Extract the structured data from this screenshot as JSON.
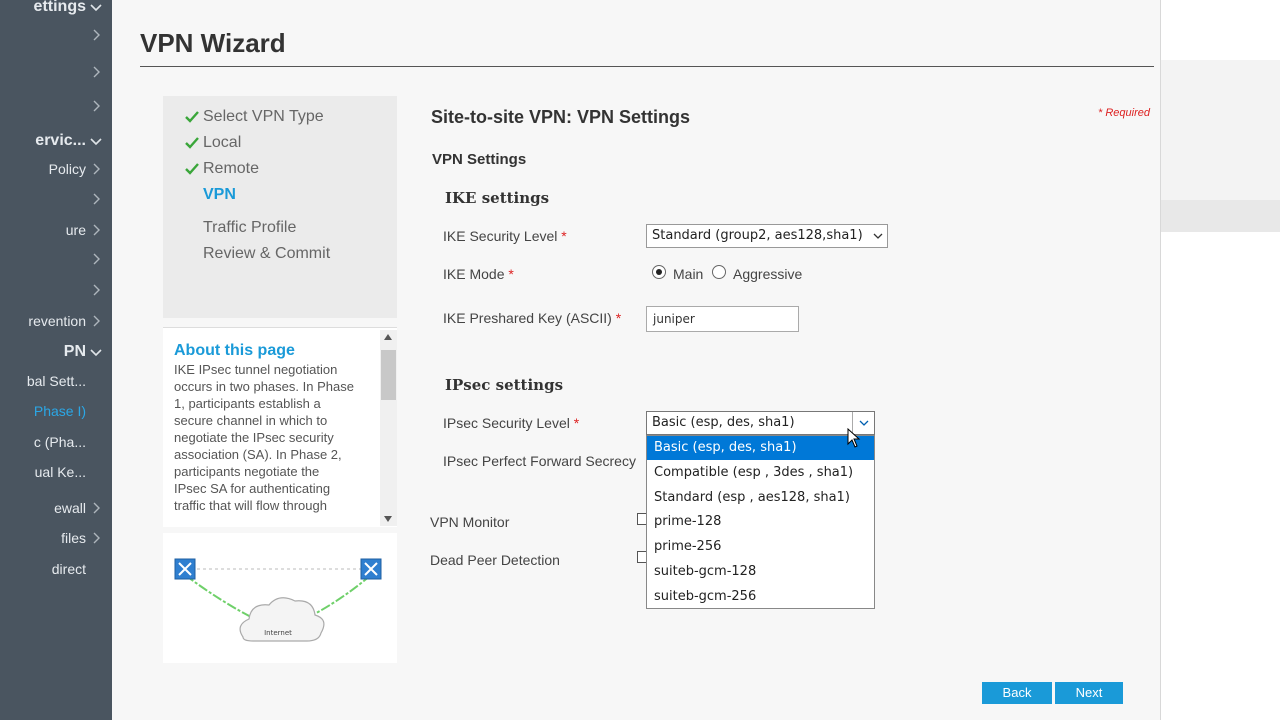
{
  "sidebar": {
    "items": [
      {
        "label": "ettings",
        "style": "bold",
        "chevron": "down"
      },
      {
        "label": "",
        "style": "",
        "chevron": "right"
      },
      {
        "label": "",
        "style": "",
        "chevron": "right"
      },
      {
        "label": "",
        "style": "",
        "chevron": "right"
      },
      {
        "label": "ervic...",
        "style": "bold",
        "chevron": "down"
      },
      {
        "label": "Policy",
        "style": "",
        "chevron": "right"
      },
      {
        "label": "",
        "style": "",
        "chevron": "right"
      },
      {
        "label": "ure",
        "style": "",
        "chevron": "right"
      },
      {
        "label": "",
        "style": "",
        "chevron": "right"
      },
      {
        "label": "",
        "style": "",
        "chevron": "right"
      },
      {
        "label": "revention",
        "style": "",
        "chevron": "right"
      },
      {
        "label": "PN",
        "style": "bold",
        "chevron": "down"
      },
      {
        "label": "bal Sett...",
        "style": "",
        "chevron": ""
      },
      {
        "label": "Phase I)",
        "style": "active",
        "chevron": ""
      },
      {
        "label": "c (Pha...",
        "style": "",
        "chevron": ""
      },
      {
        "label": "ual Ke...",
        "style": "",
        "chevron": ""
      },
      {
        "label": "ewall",
        "style": "",
        "chevron": "right"
      },
      {
        "label": "files",
        "style": "",
        "chevron": "right"
      },
      {
        "label": "direct",
        "style": "",
        "chevron": ""
      }
    ]
  },
  "page": {
    "title": "VPN Wizard",
    "required_note": "* Required"
  },
  "steps": [
    {
      "label": "Select VPN Type",
      "done": true
    },
    {
      "label": "Local",
      "done": true
    },
    {
      "label": "Remote",
      "done": true
    },
    {
      "label": "VPN",
      "done": false,
      "current": true
    },
    {
      "label": "Traffic Profile",
      "done": false
    },
    {
      "label": "Review & Commit",
      "done": false
    }
  ],
  "about": {
    "title": "About this page",
    "text": "IKE IPsec tunnel negotiation occurs in two phases. In Phase 1, participants establish a secure channel in which to negotiate the IPsec security association (SA). In Phase 2, participants negotiate the IPsec SA for authenticating traffic that will flow through"
  },
  "diagram": {
    "cloud_label": "Internet"
  },
  "form": {
    "section_title": "Site-to-site VPN: VPN Settings",
    "vpn_settings_heading": "VPN Settings",
    "ike_heading": "IKE settings",
    "ike_security_level_label": "IKE Security Level",
    "ike_security_level_value": "Standard (group2, aes128,sha1)",
    "ike_mode_label": "IKE Mode",
    "ike_mode_main": "Main",
    "ike_mode_aggressive": "Aggressive",
    "ike_psk_label": "IKE Preshared Key (ASCII)",
    "ike_psk_value": "juniper",
    "ipsec_heading": "IPsec settings",
    "ipsec_security_level_label": "IPsec Security Level",
    "ipsec_security_level_value": "Basic (esp, des, sha1)",
    "ipsec_pfs_label": "IPsec Perfect Forward Secrecy",
    "vpn_monitor_label": "VPN Monitor",
    "dpd_label": "Dead Peer Detection",
    "required_star": "*"
  },
  "ipsec_dropdown": {
    "options": [
      "Basic (esp, des, sha1)",
      "Compatible (esp , 3des , sha1)",
      "Standard (esp , aes128, sha1)",
      "prime-128",
      "prime-256",
      "suiteb-gcm-128",
      "suiteb-gcm-256"
    ],
    "selected_index": 0
  },
  "buttons": {
    "back": "Back",
    "next": "Next"
  },
  "colors": {
    "accent": "#1a9ad8",
    "sidebar_bg": "#4a5560",
    "required": "#dd2222",
    "check": "#3aa63a",
    "selection": "#0078d7"
  }
}
